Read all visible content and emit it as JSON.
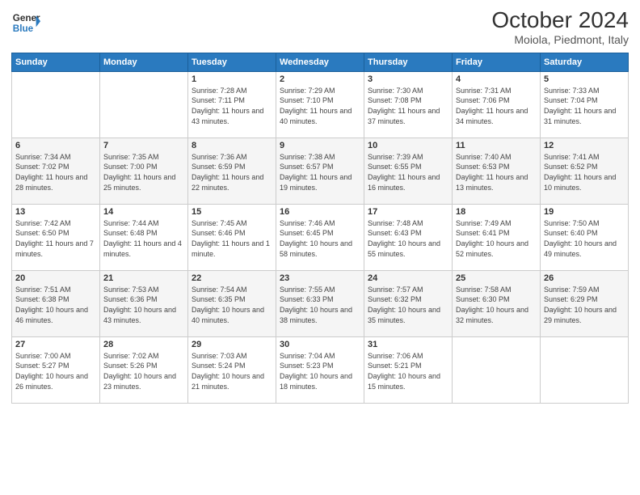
{
  "header": {
    "logo_line1": "General",
    "logo_line2": "Blue",
    "month_title": "October 2024",
    "location": "Moiola, Piedmont, Italy"
  },
  "days_of_week": [
    "Sunday",
    "Monday",
    "Tuesday",
    "Wednesday",
    "Thursday",
    "Friday",
    "Saturday"
  ],
  "weeks": [
    [
      {
        "num": "",
        "info": ""
      },
      {
        "num": "",
        "info": ""
      },
      {
        "num": "1",
        "info": "Sunrise: 7:28 AM\nSunset: 7:11 PM\nDaylight: 11 hours and 43 minutes."
      },
      {
        "num": "2",
        "info": "Sunrise: 7:29 AM\nSunset: 7:10 PM\nDaylight: 11 hours and 40 minutes."
      },
      {
        "num": "3",
        "info": "Sunrise: 7:30 AM\nSunset: 7:08 PM\nDaylight: 11 hours and 37 minutes."
      },
      {
        "num": "4",
        "info": "Sunrise: 7:31 AM\nSunset: 7:06 PM\nDaylight: 11 hours and 34 minutes."
      },
      {
        "num": "5",
        "info": "Sunrise: 7:33 AM\nSunset: 7:04 PM\nDaylight: 11 hours and 31 minutes."
      }
    ],
    [
      {
        "num": "6",
        "info": "Sunrise: 7:34 AM\nSunset: 7:02 PM\nDaylight: 11 hours and 28 minutes."
      },
      {
        "num": "7",
        "info": "Sunrise: 7:35 AM\nSunset: 7:00 PM\nDaylight: 11 hours and 25 minutes."
      },
      {
        "num": "8",
        "info": "Sunrise: 7:36 AM\nSunset: 6:59 PM\nDaylight: 11 hours and 22 minutes."
      },
      {
        "num": "9",
        "info": "Sunrise: 7:38 AM\nSunset: 6:57 PM\nDaylight: 11 hours and 19 minutes."
      },
      {
        "num": "10",
        "info": "Sunrise: 7:39 AM\nSunset: 6:55 PM\nDaylight: 11 hours and 16 minutes."
      },
      {
        "num": "11",
        "info": "Sunrise: 7:40 AM\nSunset: 6:53 PM\nDaylight: 11 hours and 13 minutes."
      },
      {
        "num": "12",
        "info": "Sunrise: 7:41 AM\nSunset: 6:52 PM\nDaylight: 11 hours and 10 minutes."
      }
    ],
    [
      {
        "num": "13",
        "info": "Sunrise: 7:42 AM\nSunset: 6:50 PM\nDaylight: 11 hours and 7 minutes."
      },
      {
        "num": "14",
        "info": "Sunrise: 7:44 AM\nSunset: 6:48 PM\nDaylight: 11 hours and 4 minutes."
      },
      {
        "num": "15",
        "info": "Sunrise: 7:45 AM\nSunset: 6:46 PM\nDaylight: 11 hours and 1 minute."
      },
      {
        "num": "16",
        "info": "Sunrise: 7:46 AM\nSunset: 6:45 PM\nDaylight: 10 hours and 58 minutes."
      },
      {
        "num": "17",
        "info": "Sunrise: 7:48 AM\nSunset: 6:43 PM\nDaylight: 10 hours and 55 minutes."
      },
      {
        "num": "18",
        "info": "Sunrise: 7:49 AM\nSunset: 6:41 PM\nDaylight: 10 hours and 52 minutes."
      },
      {
        "num": "19",
        "info": "Sunrise: 7:50 AM\nSunset: 6:40 PM\nDaylight: 10 hours and 49 minutes."
      }
    ],
    [
      {
        "num": "20",
        "info": "Sunrise: 7:51 AM\nSunset: 6:38 PM\nDaylight: 10 hours and 46 minutes."
      },
      {
        "num": "21",
        "info": "Sunrise: 7:53 AM\nSunset: 6:36 PM\nDaylight: 10 hours and 43 minutes."
      },
      {
        "num": "22",
        "info": "Sunrise: 7:54 AM\nSunset: 6:35 PM\nDaylight: 10 hours and 40 minutes."
      },
      {
        "num": "23",
        "info": "Sunrise: 7:55 AM\nSunset: 6:33 PM\nDaylight: 10 hours and 38 minutes."
      },
      {
        "num": "24",
        "info": "Sunrise: 7:57 AM\nSunset: 6:32 PM\nDaylight: 10 hours and 35 minutes."
      },
      {
        "num": "25",
        "info": "Sunrise: 7:58 AM\nSunset: 6:30 PM\nDaylight: 10 hours and 32 minutes."
      },
      {
        "num": "26",
        "info": "Sunrise: 7:59 AM\nSunset: 6:29 PM\nDaylight: 10 hours and 29 minutes."
      }
    ],
    [
      {
        "num": "27",
        "info": "Sunrise: 7:00 AM\nSunset: 5:27 PM\nDaylight: 10 hours and 26 minutes."
      },
      {
        "num": "28",
        "info": "Sunrise: 7:02 AM\nSunset: 5:26 PM\nDaylight: 10 hours and 23 minutes."
      },
      {
        "num": "29",
        "info": "Sunrise: 7:03 AM\nSunset: 5:24 PM\nDaylight: 10 hours and 21 minutes."
      },
      {
        "num": "30",
        "info": "Sunrise: 7:04 AM\nSunset: 5:23 PM\nDaylight: 10 hours and 18 minutes."
      },
      {
        "num": "31",
        "info": "Sunrise: 7:06 AM\nSunset: 5:21 PM\nDaylight: 10 hours and 15 minutes."
      },
      {
        "num": "",
        "info": ""
      },
      {
        "num": "",
        "info": ""
      }
    ]
  ]
}
